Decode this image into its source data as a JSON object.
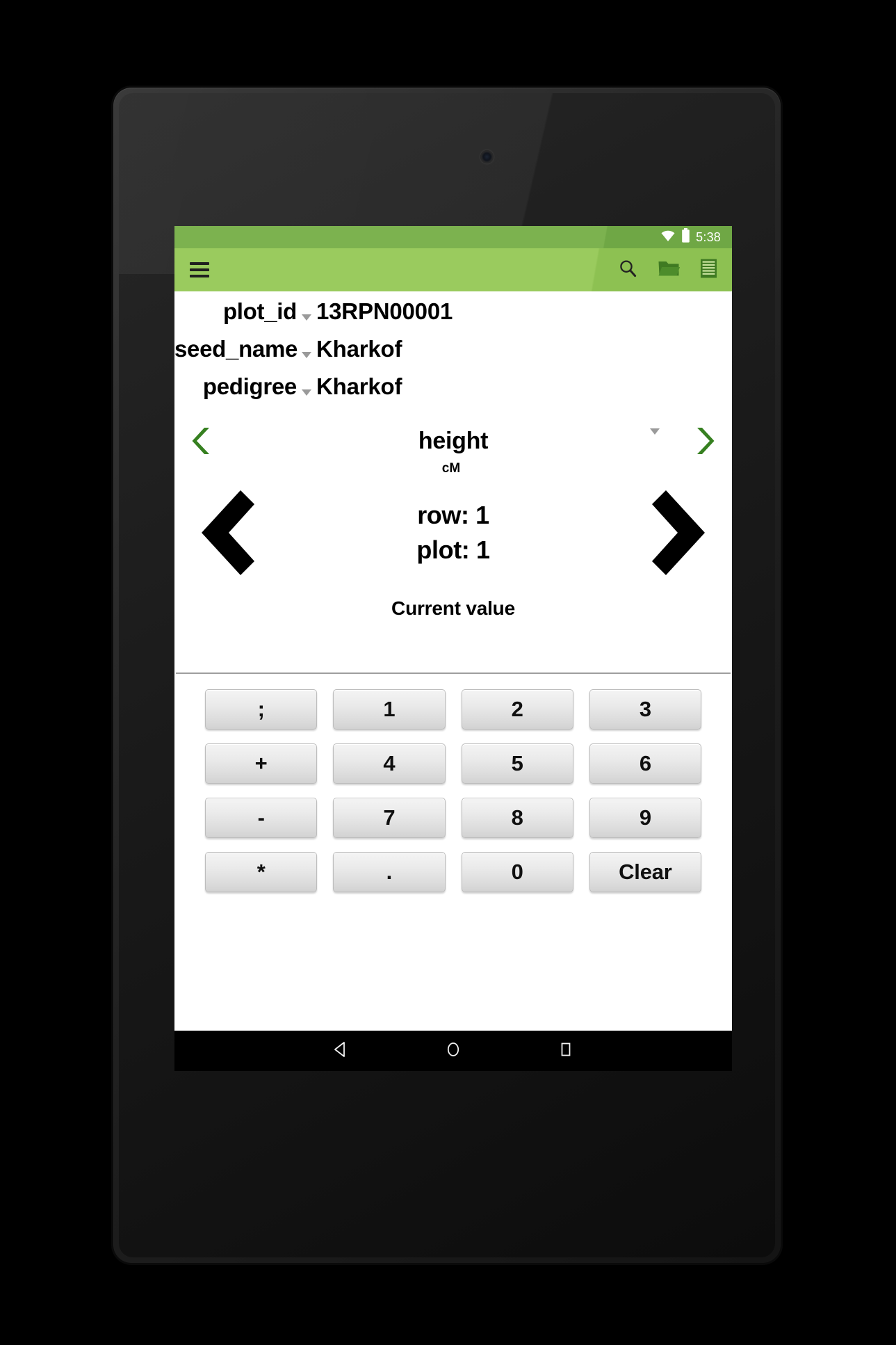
{
  "status_bar": {
    "time": "5:38",
    "wifi_icon": "wifi-icon",
    "battery_icon": "battery-icon"
  },
  "action_bar": {
    "menu_icon": "hamburger-menu-icon",
    "search_icon": "search-icon",
    "folder_icon": "folder-open-icon",
    "list_icon": "list-view-icon",
    "bar_color": "#9acb5e",
    "status_color": "#7cb24f"
  },
  "fields": [
    {
      "label": "plot_id",
      "value": "13RPN00001",
      "caret": "chevron-down-icon"
    },
    {
      "label": "seed_name",
      "value": "Kharkof",
      "caret": "chevron-down-icon"
    },
    {
      "label": "pedigree",
      "value": "Kharkof",
      "caret": "chevron-down-icon"
    }
  ],
  "trait": {
    "prev_icon": "chevron-left-icon",
    "next_icon": "chevron-right-icon",
    "name": "height",
    "unit": "cM",
    "caret": "chevron-down-icon",
    "accent_color": "#368020"
  },
  "navigation": {
    "prev_icon": "chevron-left-large-icon",
    "next_icon": "chevron-right-large-icon",
    "row_label": "row:  1",
    "plot_label": "plot:  1"
  },
  "value_section": {
    "current_value_label": "Current value",
    "current_value": ""
  },
  "keypad": {
    "rows": [
      [
        ";",
        "1",
        "2",
        "3"
      ],
      [
        "+",
        "4",
        "5",
        "6"
      ],
      [
        "-",
        "7",
        "8",
        "9"
      ],
      [
        "*",
        ".",
        "0",
        "Clear"
      ]
    ]
  },
  "android_nav": {
    "back_icon": "back-triangle-icon",
    "home_icon": "home-circle-icon",
    "recents_icon": "recents-square-icon"
  }
}
